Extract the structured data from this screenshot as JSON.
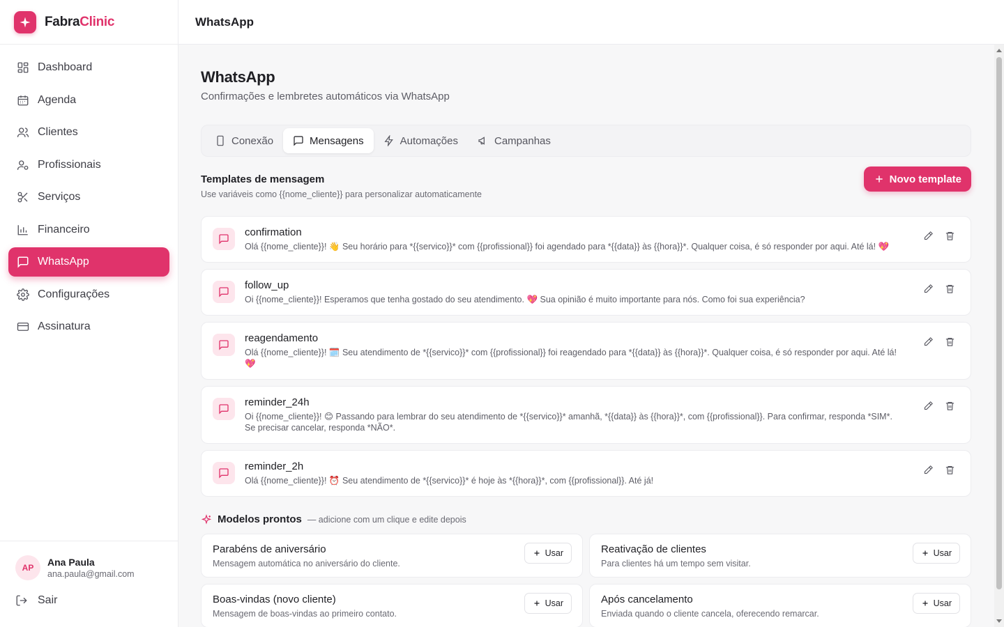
{
  "brand": {
    "name_part1": "Fabra",
    "name_part2": "Clinic",
    "accent": "#e0336b"
  },
  "sidebar": {
    "items": [
      {
        "label": "Dashboard",
        "icon": "dashboard-icon"
      },
      {
        "label": "Agenda",
        "icon": "calendar-icon"
      },
      {
        "label": "Clientes",
        "icon": "users-icon"
      },
      {
        "label": "Profissionais",
        "icon": "user-cog-icon"
      },
      {
        "label": "Serviços",
        "icon": "scissors-icon"
      },
      {
        "label": "Financeiro",
        "icon": "bar-chart-icon"
      },
      {
        "label": "WhatsApp",
        "icon": "message-icon",
        "active": true
      },
      {
        "label": "Configurações",
        "icon": "gear-icon"
      },
      {
        "label": "Assinatura",
        "icon": "credit-card-icon"
      }
    ],
    "user": {
      "initials": "AP",
      "name": "Ana Paula",
      "email": "ana.paula@gmail.com"
    },
    "logout_label": "Sair"
  },
  "topbar": {
    "title": "WhatsApp"
  },
  "page": {
    "title": "WhatsApp",
    "subtitle": "Confirmações e lembretes automáticos via WhatsApp"
  },
  "tabs": [
    {
      "label": "Conexão",
      "icon": "phone-icon"
    },
    {
      "label": "Mensagens",
      "icon": "message-icon",
      "active": true
    },
    {
      "label": "Automações",
      "icon": "lightning-icon"
    },
    {
      "label": "Campanhas",
      "icon": "megaphone-icon"
    }
  ],
  "templates_section": {
    "title": "Templates de mensagem",
    "subtitle": "Use variáveis como {{nome_cliente}} para personalizar automaticamente",
    "new_button": "Novo template"
  },
  "templates": [
    {
      "name": "confirmation",
      "text": "Olá {{nome_cliente}}! 👋 Seu horário para *{{servico}}* com {{profissional}} foi agendado para *{{data}} às {{hora}}*. Qualquer coisa, é só responder por aqui. Até lá! 💖"
    },
    {
      "name": "follow_up",
      "text": "Oi {{nome_cliente}}! Esperamos que tenha gostado do seu atendimento. 💖 Sua opinião é muito importante para nós. Como foi sua experiência?"
    },
    {
      "name": "reagendamento",
      "text": "Olá {{nome_cliente}}! 🗓️ Seu atendimento de *{{servico}}* com {{profissional}} foi reagendado para *{{data}} às {{hora}}*. Qualquer coisa, é só responder por aqui. Até lá! 💖"
    },
    {
      "name": "reminder_24h",
      "text": "Oi {{nome_cliente}}! 😊 Passando para lembrar do seu atendimento de *{{servico}}* amanhã, *{{data}} às {{hora}}*, com {{profissional}}. Para confirmar, responda *SIM*. Se precisar cancelar, responda *NÃO*."
    },
    {
      "name": "reminder_2h",
      "text": "Olá {{nome_cliente}}! ⏰ Seu atendimento de *{{servico}}* é hoje às *{{hora}}*, com {{profissional}}. Até já!"
    }
  ],
  "models_section": {
    "title": "Modelos prontos",
    "note": "— adicione com um clique e edite depois",
    "use_label": "Usar"
  },
  "models": [
    {
      "title": "Parabéns de aniversário",
      "desc": "Mensagem automática no aniversário do cliente."
    },
    {
      "title": "Reativação de clientes",
      "desc": "Para clientes há um tempo sem visitar."
    },
    {
      "title": "Boas-vindas (novo cliente)",
      "desc": "Mensagem de boas-vindas ao primeiro contato."
    },
    {
      "title": "Após cancelamento",
      "desc": "Enviada quando o cliente cancela, oferecendo remarcar."
    }
  ]
}
